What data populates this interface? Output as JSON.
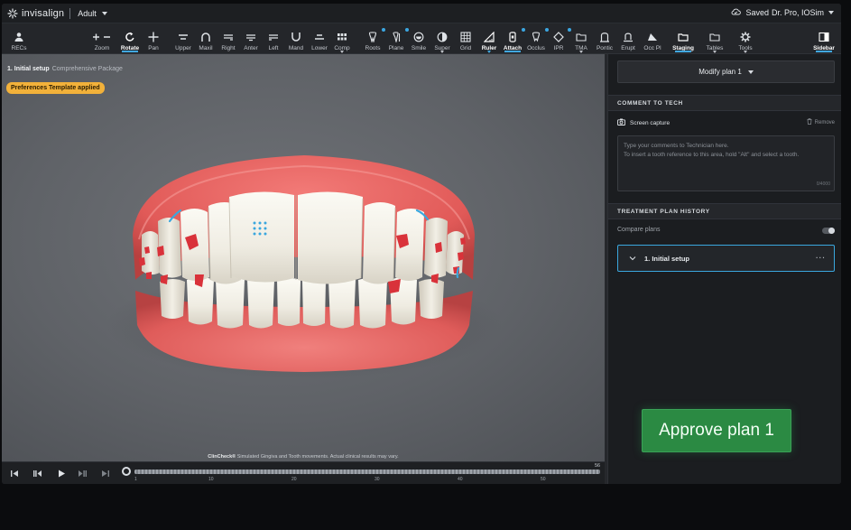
{
  "app": {
    "brand": "invisalign",
    "profile": "Adult",
    "saved_label": "Saved",
    "user": "Dr. Pro, IOSim"
  },
  "toolbar": {
    "tools": [
      {
        "id": "recs",
        "label": "RECs",
        "icon": "person-icon"
      },
      {
        "id": "zoom",
        "label": "Zoom",
        "icon": "zoom-plus-minus-icon"
      },
      {
        "id": "rotate",
        "label": "Rotate",
        "icon": "rotate-icon",
        "active": true
      },
      {
        "id": "pan",
        "label": "Pan",
        "icon": "pan-cross-icon"
      },
      {
        "id": "upper",
        "label": "Upper",
        "icon": "upper-view-icon"
      },
      {
        "id": "maxil",
        "label": "Maxil",
        "icon": "maxillary-arch-icon"
      },
      {
        "id": "right",
        "label": "Right",
        "icon": "right-view-icon"
      },
      {
        "id": "anter",
        "label": "Anter",
        "icon": "anterior-view-icon"
      },
      {
        "id": "left",
        "label": "Left",
        "icon": "left-view-icon"
      },
      {
        "id": "mand",
        "label": "Mand",
        "icon": "mandibular-arch-icon"
      },
      {
        "id": "lower",
        "label": "Lower",
        "icon": "lower-view-icon"
      },
      {
        "id": "comp",
        "label": "Comp",
        "icon": "compare-grid-icon"
      },
      {
        "id": "roots",
        "label": "Roots",
        "icon": "tooth-roots-icon"
      },
      {
        "id": "plane",
        "label": "Plane",
        "icon": "plane-icon"
      },
      {
        "id": "smile",
        "label": "Smile",
        "icon": "smile-icon"
      },
      {
        "id": "super",
        "label": "Super",
        "icon": "superimpose-icon"
      },
      {
        "id": "grid",
        "label": "Grid",
        "icon": "grid-icon"
      },
      {
        "id": "ruler",
        "label": "Ruler",
        "icon": "ruler-icon",
        "active": true
      },
      {
        "id": "attach",
        "label": "Attach",
        "icon": "attachment-icon",
        "active": true
      },
      {
        "id": "occlus",
        "label": "Occlus",
        "icon": "occlusion-icon"
      },
      {
        "id": "ipr",
        "label": "IPR",
        "icon": "ipr-diamond-icon"
      },
      {
        "id": "tma",
        "label": "TMA",
        "icon": "folder-icon"
      },
      {
        "id": "pontic",
        "label": "Pontic",
        "icon": "pontic-icon"
      },
      {
        "id": "erupt",
        "label": "Erupt",
        "icon": "eruption-icon"
      },
      {
        "id": "occpl",
        "label": "Occ Pl",
        "icon": "occlusal-plane-icon"
      },
      {
        "id": "staging",
        "label": "Staging",
        "icon": "staging-folder-icon",
        "active": true
      },
      {
        "id": "tables",
        "label": "Tables",
        "icon": "tables-folder-icon"
      },
      {
        "id": "tools",
        "label": "Tools",
        "icon": "gear-icon"
      },
      {
        "id": "sidebar",
        "label": "Sidebar",
        "icon": "sidebar-panel-icon",
        "active": true
      }
    ]
  },
  "viewport": {
    "step_title": "1. Initial setup",
    "step_subtitle": "Comprehensive Package",
    "badge": "Preferences Template applied",
    "disclaimer_bold": "ClinCheck®",
    "disclaimer_text": "Simulated Gingiva and Tooth movements. Actual clinical results may vary."
  },
  "timeline": {
    "end_stage": "56",
    "ticks": [
      "1",
      "10",
      "20",
      "30",
      "40",
      "50"
    ],
    "current_stage_fraction": 1.0
  },
  "sidebar": {
    "modify_plan": "Modify plan 1",
    "comment_header": "COMMENT TO TECH",
    "screen_capture": "Screen capture",
    "remove": "Remove",
    "comment_placeholder_1": "Type your comments to Technician here.",
    "comment_placeholder_2": "To insert a tooth reference to this area, hold \"Alt\" and select a tooth.",
    "char_count": "0/4000",
    "history_header": "TREATMENT PLAN HISTORY",
    "compare_plans": "Compare plans",
    "plan_item": "1. Initial setup",
    "approve": "Approve plan 1"
  },
  "colors": {
    "accent_blue": "#3aa7de",
    "badge_yellow": "#f2b13a",
    "approve_green": "#2b8a43",
    "gum_red": "#e4605f",
    "attachment_red": "#d9323a"
  }
}
